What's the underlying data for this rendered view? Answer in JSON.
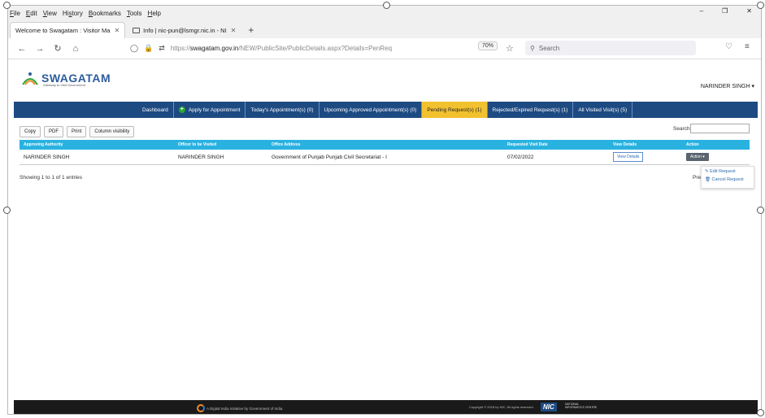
{
  "browser": {
    "menu": [
      {
        "u": "F",
        "rest": "ile"
      },
      {
        "u": "E",
        "rest": "dit"
      },
      {
        "u": "V",
        "rest": "iew"
      },
      {
        "u": "",
        "rest": "Hi",
        "u2": "s",
        "rest2": "tory"
      },
      {
        "u": "B",
        "rest": "ookmarks"
      },
      {
        "u": "T",
        "rest": "ools"
      },
      {
        "u": "H",
        "rest": "elp"
      }
    ],
    "tabs": [
      {
        "title": "Welcome to Swagatam : Visitor Ma",
        "active": true
      },
      {
        "title": "Info | nic-pun@lsmgr.nic.in - NI",
        "active": false
      }
    ],
    "new_tab": "+",
    "url_scheme": "https://",
    "url_domain": "swagatam.gov.in",
    "url_path": "/NEW/PublicSite/PublicDetails.aspx?Details=PenReq",
    "zoom": "70%",
    "search_placeholder": "Search"
  },
  "site": {
    "logo_text": "SWAGATAM",
    "logo_sub": "Gateway to Visit Government",
    "user": "NARINDER SINGH ▾",
    "nav": [
      {
        "label": "Dashboard",
        "highlight": false
      },
      {
        "label": "Apply for Appointment",
        "highlight": false
      },
      {
        "label": "Today's Appointment(s) (0)",
        "highlight": false
      },
      {
        "label": "Upcoming Approved Appointment(s) (0)",
        "highlight": false
      },
      {
        "label": "Pending Request(s) (1)",
        "highlight": true
      },
      {
        "label": "Rejected/Expired Request(s) (1)",
        "highlight": false
      },
      {
        "label": "All Visited Visit(s) (5)",
        "highlight": false
      }
    ]
  },
  "table_tools": {
    "buttons": [
      "Copy",
      "PDF",
      "Print",
      "Column visibility"
    ],
    "search_label": "Search:"
  },
  "table": {
    "headers": [
      "Approving Authority",
      "Officer to be Visited",
      "Office Address",
      "Requested Visit Date",
      "View Details",
      "Action"
    ],
    "rows": [
      {
        "authority": "NARINDER SINGH",
        "officer": "NARINDER SINGH",
        "address": "Government of Punjab Punjab Civil Secretariat - I",
        "date": "07/02/2022",
        "view": "View Details",
        "action": "Action ▾"
      }
    ],
    "showing": "Showing 1 to 1 of 1 entries",
    "prev": "Pre",
    "action_menu": [
      "✎ Edit Request",
      "🗑 Cancel Request"
    ]
  },
  "footer": {
    "left": "A Digital India Initiative by Government of India.",
    "copyright": "Copyright © 2018 by NIC. All rights reserved.",
    "nic": "NIC",
    "nic_sub": "NATIONAL INFORMATICS CENTRE"
  }
}
